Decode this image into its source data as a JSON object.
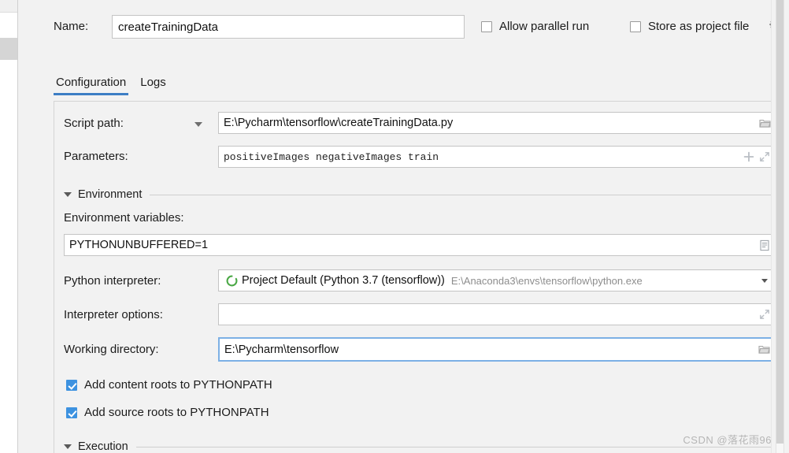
{
  "window": {
    "name_label": "Name:",
    "name_value": "createTrainingData",
    "allow_parallel_run": "Allow parallel run",
    "store_as_project_file": "Store as project file",
    "gear_icon": "gear-icon"
  },
  "tabs": [
    {
      "label": "Configuration",
      "active": true
    },
    {
      "label": "Logs",
      "active": false
    }
  ],
  "form": {
    "script_path": {
      "label": "Script path:",
      "value": "E:\\Pycharm\\tensorflow\\createTrainingData.py",
      "browse_icon": "folder-icon",
      "dropdown_icon": "chevron-down-icon"
    },
    "parameters": {
      "label": "Parameters:",
      "value": "positiveImages negativeImages train",
      "add_icon": "plus-icon",
      "expand_icon": "expand-icon"
    },
    "environment_section": {
      "title": "Environment",
      "collapse_icon": "triangle-down-icon"
    },
    "environment_variables": {
      "label": "Environment variables:",
      "value": "PYTHONUNBUFFERED=1",
      "browse_icon": "list-edit-icon"
    },
    "python_interpreter": {
      "label": "Python interpreter:",
      "value": "Project Default (Python 3.7 (tensorflow))",
      "hint": "E:\\Anaconda3\\envs\\tensorflow\\python.exe",
      "status_icon": "python-env-icon",
      "dropdown_icon": "chevron-down-icon"
    },
    "interpreter_options": {
      "label": "Interpreter options:",
      "value": "",
      "expand_icon": "expand-icon"
    },
    "working_directory": {
      "label": "Working directory:",
      "value": "E:\\Pycharm\\tensorflow",
      "browse_icon": "folder-icon",
      "focused": true
    },
    "add_content_roots": {
      "label": "Add content roots to PYTHONPATH",
      "checked": true
    },
    "add_source_roots": {
      "label": "Add source roots to PYTHONPATH",
      "checked": true
    },
    "execution_section": {
      "title": "Execution",
      "collapse_icon": "triangle-down-icon"
    }
  },
  "watermark": "CSDN @落花雨96",
  "colors": {
    "accent": "#3d7ec4",
    "checkbox_checked": "#3d92e0",
    "focus_border": "#7cb0e5",
    "panel_bg": "#f2f2f2"
  }
}
